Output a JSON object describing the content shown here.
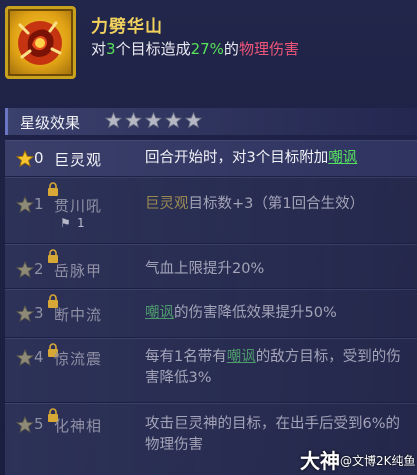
{
  "skill": {
    "name": "力劈华山",
    "icon": "fist-skill-icon",
    "desc_prefix": "对",
    "desc_count": "3",
    "desc_middle": "个目标造成",
    "desc_percent": "27%",
    "desc_of": "的",
    "desc_damage": "物理伤害"
  },
  "star_section": {
    "label": "星级效果",
    "stars_count": 5
  },
  "rows": [
    {
      "num": "0",
      "name": "巨灵观",
      "text_a": "回合开始时，对3个目标附加",
      "text_b": "嘲讽",
      "text_c": "",
      "locked": false
    },
    {
      "num": "1",
      "name": "贯川吼",
      "text_a": "巨灵观",
      "text_b": "目标数+3（第1回合生效）",
      "text_c": "",
      "flag": "1",
      "locked": true
    },
    {
      "num": "2",
      "name": "岳脉甲",
      "text_a": "气血上限提升20%",
      "locked": true
    },
    {
      "num": "3",
      "name": "断中流",
      "text_a": "嘲讽",
      "text_b": "的伤害降低效果提升50%",
      "locked": true
    },
    {
      "num": "4",
      "name": "惊流震",
      "text_a": "每有1名带有",
      "text_b": "嘲讽",
      "text_c": "的敌方目标，受到的伤害降低3%",
      "locked": true
    },
    {
      "num": "5",
      "name": "化神相",
      "text_a": "攻击巨灵神的目标，在出手后受到6%的物理伤害",
      "locked": true
    }
  ],
  "watermark": {
    "big": "大神",
    "small": "@文博2K纯鱼"
  },
  "colors": {
    "accent_gold": "#f2d25c",
    "green": "#58e25a",
    "red": "#f0557a"
  }
}
